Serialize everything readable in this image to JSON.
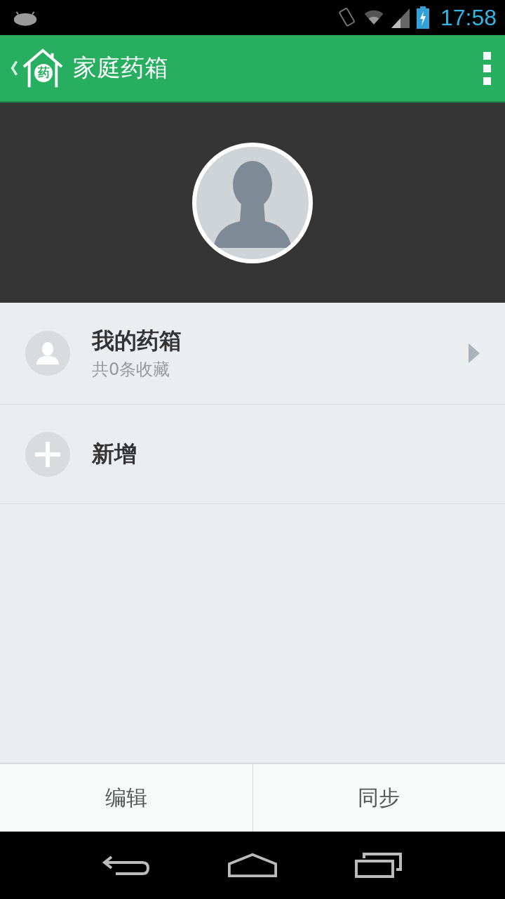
{
  "status_bar": {
    "time": "17:58"
  },
  "app_bar": {
    "logo_glyph": "药",
    "title": "家庭药箱"
  },
  "list": [
    {
      "kind": "box",
      "title": "我的药箱",
      "subtitle": "共0条收藏"
    },
    {
      "kind": "add",
      "title": "新增"
    }
  ],
  "buttons": [
    "编辑",
    "同步"
  ]
}
